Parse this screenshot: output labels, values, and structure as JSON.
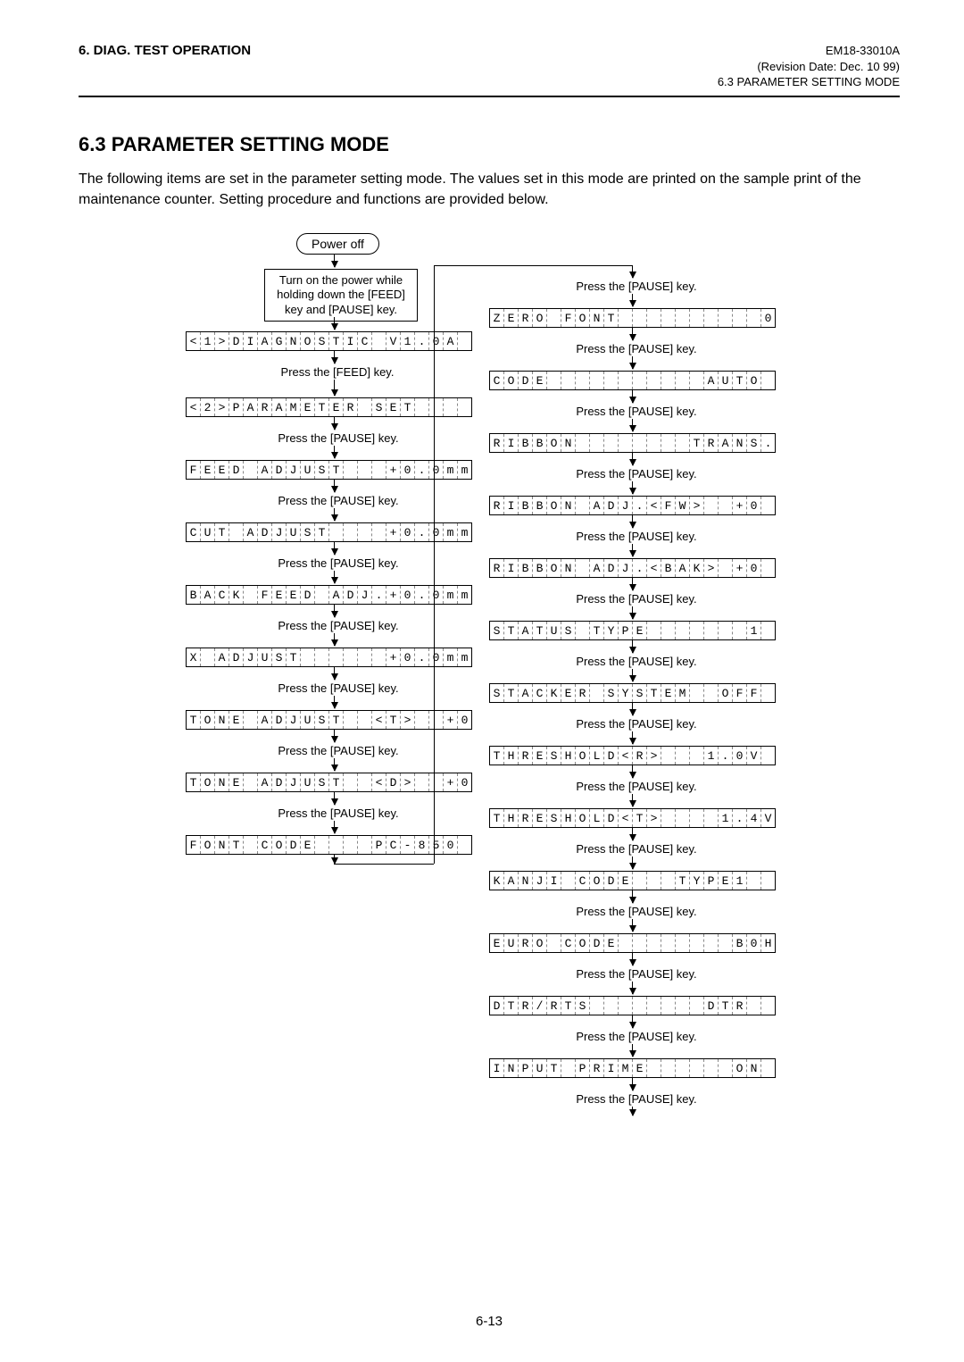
{
  "doc": {
    "section_left": "6. DIAG. TEST OPERATION",
    "code": "EM18-33010A",
    "revision": "(Revision Date: Dec. 10  99)",
    "breadcrumb": "6.3 PARAMETER SETTING MODE",
    "title": "6.3  PARAMETER SETTING MODE",
    "intro": "The following items are set in the parameter setting mode.  The values set in this mode are printed on the sample print of the maintenance counter.  Setting procedure and functions are provided below.",
    "page_no": "6-13"
  },
  "flow": {
    "power_off": "Power off",
    "turn_on": "Turn on the power while holding down the [FEED] key and [PAUSE] key.",
    "press_feed": "Press the [FEED] key.",
    "press_pause": "Press the [PAUSE] key."
  },
  "lcd_left": [
    "<1>DIAGNOSTIC V1.0A",
    "<2>PARAMETER SET   ",
    "FEED ADJUST   +0.0mm",
    "CUT ADJUST    +0.0mm",
    "BACK FEED ADJ.+0.0mm",
    "X ADJUST      +0.0mm",
    "TONE ADJUST  <T>  +0",
    "TONE ADJUST  <D>  +0",
    "FONT CODE    PC-850"
  ],
  "lcd_right": [
    "ZERO FONT          0",
    "CODE           AUTO",
    "RIBBON        TRANS.",
    "RIBBON ADJ.<FW>  +0",
    "RIBBON ADJ.<BAK> +0",
    "STATUS TYPE       1 ",
    "STACKER SYSTEM  OFF",
    "THRESHOLD<R>   1.0V",
    "THRESHOLD<T>    1.4V",
    "KANJI CODE   TYPE1 ",
    "EURO CODE        B0H",
    "DTR/RTS        DTR  ",
    "INPUT PRIME      ON "
  ]
}
